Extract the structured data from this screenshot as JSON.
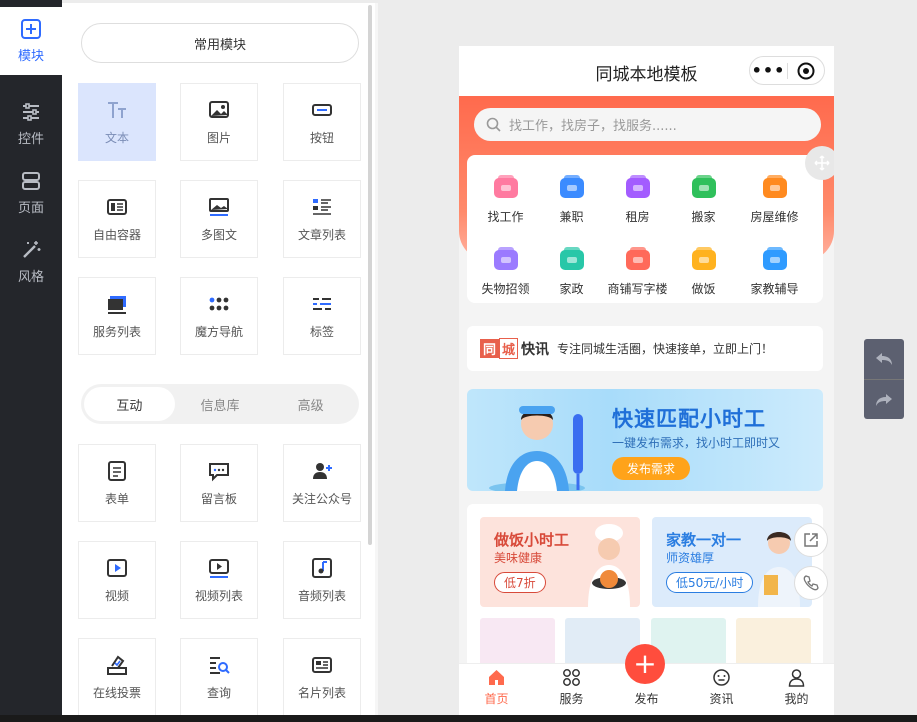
{
  "rail": {
    "items": [
      {
        "label": "模块",
        "icon": "plus-square-icon",
        "active": true
      },
      {
        "label": "控件",
        "icon": "sliders-icon",
        "active": false
      },
      {
        "label": "页面",
        "icon": "pages-icon",
        "active": false
      },
      {
        "label": "风格",
        "icon": "magic-wand-icon",
        "active": false
      }
    ]
  },
  "panel": {
    "common_label": "常用模块",
    "common_tiles": [
      {
        "label": "文本",
        "icon": "text-icon",
        "selected": true
      },
      {
        "label": "图片",
        "icon": "image-icon"
      },
      {
        "label": "按钮",
        "icon": "button-icon"
      },
      {
        "label": "自由容器",
        "icon": "container-icon"
      },
      {
        "label": "多图文",
        "icon": "multi-image-text-icon"
      },
      {
        "label": "文章列表",
        "icon": "article-list-icon"
      },
      {
        "label": "服务列表",
        "icon": "service-list-icon"
      },
      {
        "label": "魔方导航",
        "icon": "grid-nav-icon"
      },
      {
        "label": "标签",
        "icon": "tag-icon"
      }
    ],
    "tabs": [
      {
        "label": "互动",
        "active": true
      },
      {
        "label": "信息库",
        "active": false
      },
      {
        "label": "高级",
        "active": false
      }
    ],
    "interactive_tiles": [
      {
        "label": "表单",
        "icon": "form-icon"
      },
      {
        "label": "留言板",
        "icon": "message-board-icon"
      },
      {
        "label": "关注公众号",
        "icon": "follow-account-icon"
      },
      {
        "label": "视频",
        "icon": "video-icon"
      },
      {
        "label": "视频列表",
        "icon": "video-list-icon"
      },
      {
        "label": "音频列表",
        "icon": "audio-list-icon"
      },
      {
        "label": "在线投票",
        "icon": "vote-icon"
      },
      {
        "label": "查询",
        "icon": "query-icon"
      },
      {
        "label": "名片列表",
        "icon": "business-card-icon"
      }
    ]
  },
  "phone": {
    "title": "同城本地模板",
    "capsule_dots": "•••",
    "search_placeholder": "找工作，找房子，找服务......",
    "categories": [
      {
        "label": "找工作",
        "icon": "briefcase-icon",
        "color": "#ff7aa0"
      },
      {
        "label": "兼职",
        "icon": "clock-icon",
        "color": "#3b8bff"
      },
      {
        "label": "租房",
        "icon": "house-icon",
        "color": "#a35cff"
      },
      {
        "label": "搬家",
        "icon": "truck-icon",
        "color": "#2fc05b"
      },
      {
        "label": "房屋维修",
        "icon": "roof-icon",
        "color": "#ff8a1f"
      },
      {
        "label": "失物招领",
        "icon": "wallet-icon",
        "color": "#9b7bff"
      },
      {
        "label": "家政",
        "icon": "bucket-icon",
        "color": "#28c7a8"
      },
      {
        "label": "商铺写字楼",
        "icon": "shop-icon",
        "color": "#ff6a5a"
      },
      {
        "label": "做饭",
        "icon": "cloche-icon",
        "color": "#ffb21f"
      },
      {
        "label": "家教辅导",
        "icon": "tutor-icon",
        "color": "#2f9bff"
      }
    ],
    "news": {
      "logo_a": "同",
      "logo_b": "城",
      "logo_c": "快讯",
      "text": "专注同城生活圈，快速接单，立即上门！"
    },
    "banner": {
      "title": "快速匹配小时工",
      "subtitle": "一键发布需求，找小时工即时又",
      "button": "发布需求"
    },
    "promos": [
      {
        "title": "做饭小时工",
        "subtitle": "美味健康",
        "tag": "低7折",
        "color": "#d84a3a",
        "bg": "#fde3dc"
      },
      {
        "title": "家教一对一",
        "subtitle": "师资雄厚",
        "tag": "低50元/小时",
        "color": "#2a7de1",
        "bg": "#dcebfb"
      }
    ],
    "tabbar": [
      {
        "label": "首页",
        "icon": "home-icon",
        "active": true
      },
      {
        "label": "服务",
        "icon": "services-icon",
        "active": false
      },
      {
        "label": "发布",
        "icon": "publish-icon",
        "active": false
      },
      {
        "label": "资讯",
        "icon": "news-icon",
        "active": false
      },
      {
        "label": "我的",
        "icon": "user-icon",
        "active": false
      }
    ],
    "fab_symbol": "+"
  },
  "colors": {
    "accent": "#2f6bff",
    "brand": "#ff6a4d",
    "rail": "#24262b"
  }
}
